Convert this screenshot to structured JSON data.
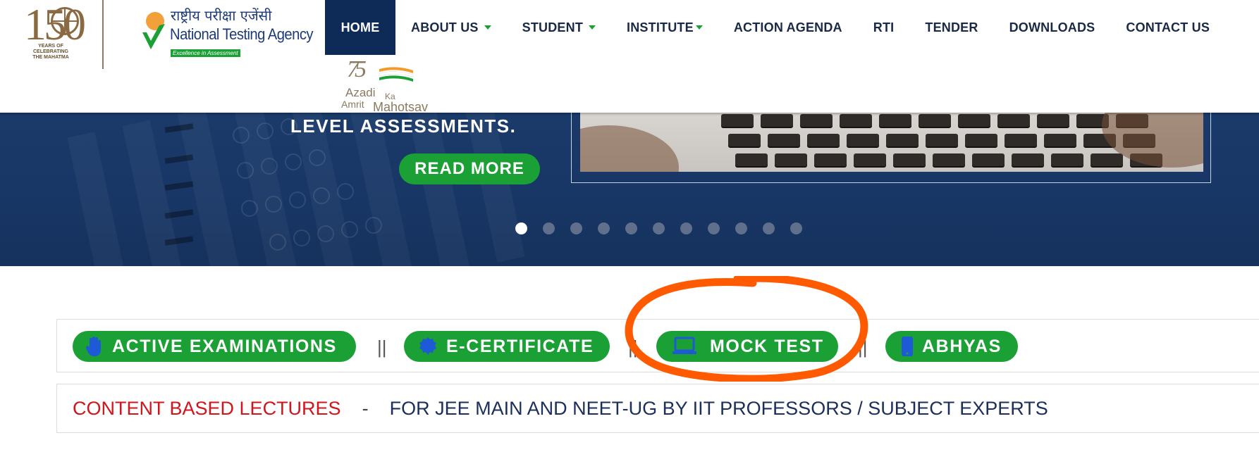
{
  "header": {
    "logo150": {
      "number": "150",
      "caption": "YEARS OF CELEBRATING THE MAHATMA"
    },
    "nta_logo": {
      "hindi": "राष्ट्रीय परीक्षा एजेंसी",
      "english": "National Testing Agency",
      "tagline": "Excellence in Assessment"
    },
    "nav": [
      {
        "label": "HOME",
        "dropdown": false,
        "active": true
      },
      {
        "label": "ABOUT US",
        "dropdown": true
      },
      {
        "label": "STUDENT",
        "dropdown": true
      },
      {
        "label": "INSTITUTE",
        "dropdown": true
      },
      {
        "label": "ACTION AGENDA",
        "dropdown": false
      },
      {
        "label": "RTI",
        "dropdown": false
      },
      {
        "label": "TENDER",
        "dropdown": false
      },
      {
        "label": "DOWNLOADS",
        "dropdown": false
      },
      {
        "label": "CONTACT US",
        "dropdown": false
      }
    ],
    "azadi_logo": {
      "number": "75",
      "line1": "Azadi",
      "line2": "Ka",
      "line3": "Amrit",
      "line4": "Mahotsav"
    }
  },
  "banner": {
    "headline": "LEVEL ASSESSMENTS.",
    "button": "READ MORE",
    "slide_count": 11,
    "active_slide": 1
  },
  "quick_links": {
    "items": [
      {
        "label": "ACTIVE EXAMINATIONS",
        "icon": "hand-icon"
      },
      {
        "label": "E-CERTIFICATE",
        "icon": "badge-icon"
      },
      {
        "label": "MOCK TEST",
        "icon": "laptop-icon"
      },
      {
        "label": "ABHYAS",
        "icon": "mobile-icon"
      }
    ],
    "separator": "||"
  },
  "lecture": {
    "title": "CONTENT BASED LECTURES",
    "dash": "-",
    "text": "FOR JEE MAIN AND NEET-UG BY IIT PROFESSORS / SUBJECT EXPERTS"
  },
  "colors": {
    "navy": "#0e2b58",
    "green": "#1aa035",
    "highlight": "#ff5a00",
    "red": "#d0161b"
  }
}
